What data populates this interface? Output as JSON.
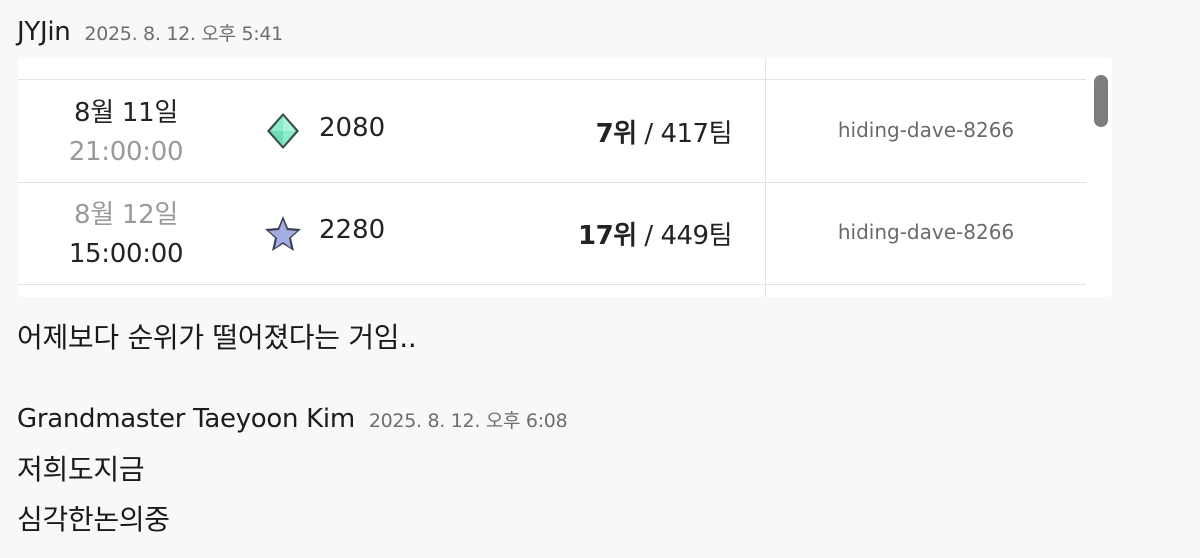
{
  "messages": [
    {
      "author": "JYJin",
      "timestamp": "2025. 8. 12. 오후 5:41",
      "attachment": {
        "rows": [
          {
            "date": "8월 11일",
            "time": "21:00:00",
            "tier_icon": "diamond-tier-icon",
            "tier_color": "#7ee6c4",
            "rating": "2080",
            "place": "7위",
            "separator": " / ",
            "teams": "417팀",
            "handle": "hiding-dave-8266"
          },
          {
            "date": "8월 12일",
            "time": "15:00:00",
            "tier_icon": "star-tier-icon",
            "tier_color": "#9aa6d6",
            "rating": "2280",
            "place": "17위",
            "separator": " / ",
            "teams": "449팀",
            "handle": "hiding-dave-8266"
          }
        ]
      },
      "text": "어제보다 순위가 떨어졌다는 거임.."
    },
    {
      "author": "Grandmaster Taeyoon Kim",
      "timestamp": "2025. 8. 12. 오후 6:08",
      "lines": [
        "저희도지금",
        "심각한논의중"
      ]
    }
  ]
}
